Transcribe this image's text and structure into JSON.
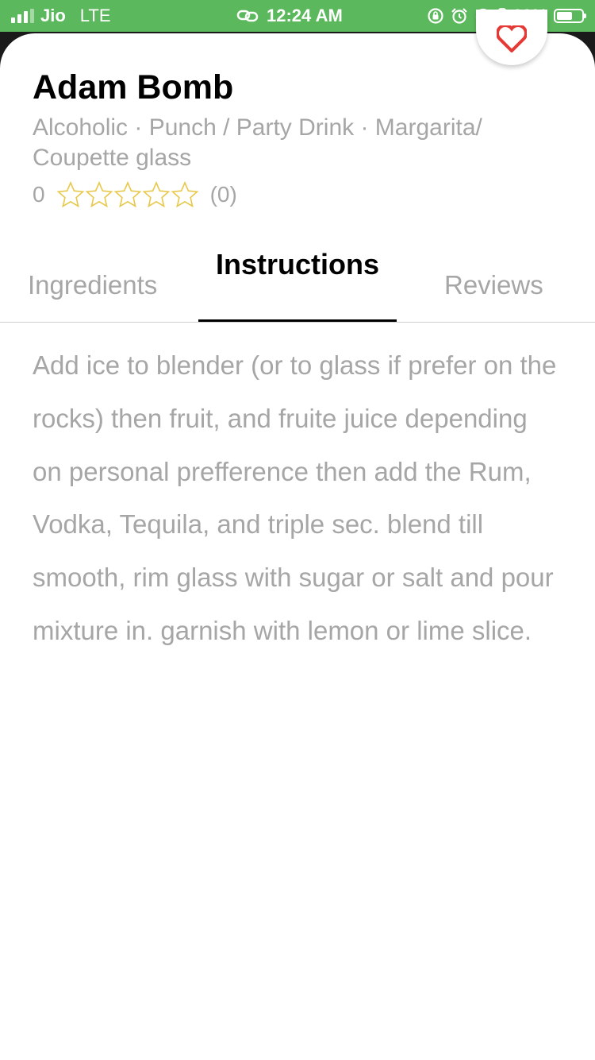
{
  "status_bar": {
    "carrier": "Jio",
    "network": "LTE",
    "time": "12:24 AM",
    "battery": "69%",
    "battery_level": 0.69,
    "icons": [
      "link-icon",
      "orientation-lock-icon",
      "alarm-icon",
      "headphones-icon",
      "battery-icon"
    ]
  },
  "drink": {
    "name": "Adam Bomb",
    "meta_text": "Alcoholic · Punch / Party Drink · Margarita/ Coupette glass",
    "rating_value": "0",
    "rating_stars": 0,
    "rating_count": "(0)"
  },
  "tabs": {
    "ingredients": "Ingredients",
    "instructions": "Instructions",
    "reviews": "Reviews",
    "active": "instructions"
  },
  "instructions_text": "Add ice to blender (or to glass if prefer on the rocks) then fruit, and fruite juice depending on personal prefference then add the Rum, Vodka, Tequila, and triple sec. blend till smooth, rim glass with sugar or salt and pour mixture in. garnish with lemon or lime slice.",
  "colors": {
    "status_bar": "#5cb85c",
    "heart": "#e53935",
    "star_outline": "#e8c84a",
    "muted_text": "#a6a6a6"
  }
}
